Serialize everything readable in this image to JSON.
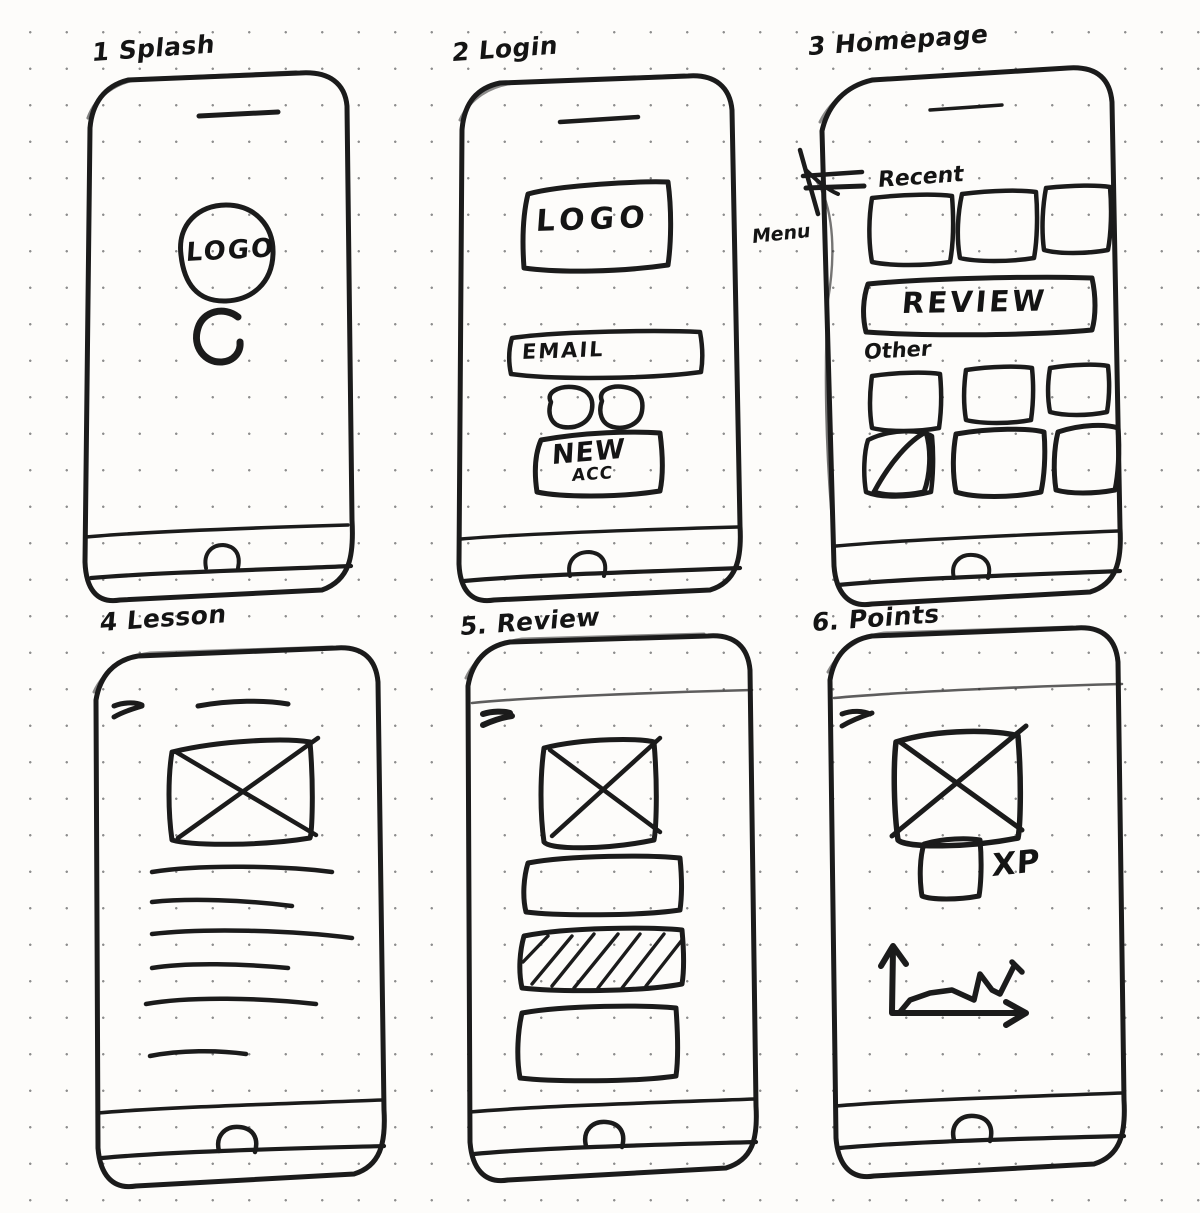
{
  "document": {
    "type": "hand-drawn-wireframe-sketch",
    "medium": "black marker on dotted grid paper",
    "layout": "3 columns x 2 rows of mobile phone wireframes",
    "ink_color": "#1b1b1b",
    "paper_color": "#fdfcfa",
    "dot_color": "#8d8d8d"
  },
  "screens": [
    {
      "id": "splash",
      "number": "1",
      "label": "1 Splash",
      "elements": {
        "logo_circle_text": "LOGO",
        "spinner": "loading-spinner-arc",
        "speaker": "earpiece-speaker-slot",
        "home_button": "home-button"
      }
    },
    {
      "id": "login",
      "number": "2",
      "label": "2 Login",
      "elements": {
        "logo_box_text": "LOGO",
        "email_field": "EMAIL",
        "social_buttons": [
          "social-login-1",
          "social-login-2"
        ],
        "primary_button_line1": "NEW",
        "primary_button_line2": "ACC",
        "speaker": "earpiece-speaker-slot",
        "home_button": "home-button"
      }
    },
    {
      "id": "homepage",
      "number": "3",
      "label": "3 Homepage",
      "annotation": "Menu",
      "elements": {
        "menu_icon": "hamburger-menu-icon",
        "section_recent": "Recent",
        "recent_cards": [
          "recent-card-1",
          "recent-card-2",
          "recent-card-3"
        ],
        "review_banner": "REVIEW",
        "section_other": "Other",
        "other_cards": [
          "other-card-1",
          "other-card-2",
          "other-card-3",
          "other-card-4-play",
          "other-card-5",
          "other-card-6"
        ],
        "home_button": "home-button"
      }
    },
    {
      "id": "lesson",
      "number": "4",
      "label": "4 Lesson",
      "elements": {
        "back_arrow": "back-arrow-icon",
        "title_rule": "lesson-title-placeholder",
        "media_placeholder": "image-placeholder-crossed-box",
        "body_lines": 6,
        "home_button": "home-button"
      }
    },
    {
      "id": "review",
      "number": "5",
      "label": "5. Review",
      "elements": {
        "back_arrow": "back-arrow-icon",
        "media_placeholder": "image-placeholder-crossed-box",
        "options": [
          {
            "name": "answer-option-1",
            "state": "unselected"
          },
          {
            "name": "answer-option-2",
            "state": "selected-hatched"
          },
          {
            "name": "answer-option-3",
            "state": "unselected"
          }
        ],
        "home_button": "home-button"
      }
    },
    {
      "id": "points",
      "number": "6",
      "label": "6. Points",
      "elements": {
        "back_arrow": "back-arrow-icon",
        "badge_placeholder": "image-placeholder-crossed-box",
        "xp_swatch": "xp-icon-box",
        "xp_label": "XP",
        "progress_chart": "line-chart-upward-trend",
        "home_button": "home-button"
      }
    }
  ],
  "chart_data": {
    "type": "line",
    "title": "XP progress",
    "xlabel": "",
    "ylabel": "",
    "x": [
      0,
      1,
      2,
      3,
      4,
      5,
      6,
      7
    ],
    "values": [
      18,
      30,
      38,
      33,
      30,
      70,
      45,
      84
    ],
    "ylim": [
      0,
      100
    ],
    "grid": false,
    "legend": "none",
    "axes": "hand-drawn arrows, up and right"
  }
}
